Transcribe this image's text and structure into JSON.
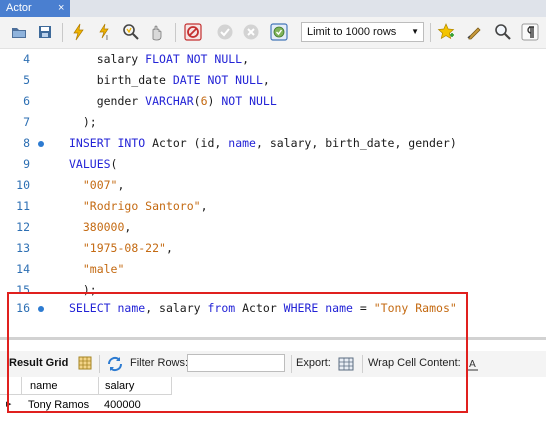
{
  "tab": {
    "title": "Actor",
    "close_glyph": "×"
  },
  "toolbar": {
    "limit_label": "Limit to 1000 rows",
    "icons": [
      "open-file-icon",
      "save-icon",
      "execute-icon",
      "execute-current-icon",
      "explain-icon",
      "stop-icon",
      "toggle-continue-on-error-icon",
      "commit-icon",
      "rollback-icon",
      "autocommit-icon",
      "beautify-icon",
      "find-icon",
      "invisible-chars-icon"
    ]
  },
  "editor": {
    "lines": [
      {
        "n": "4",
        "tokens": [
          [
            "plain",
            "    salary "
          ],
          [
            "kw",
            "FLOAT NOT NULL"
          ],
          [
            "plain",
            ","
          ]
        ]
      },
      {
        "n": "5",
        "tokens": [
          [
            "plain",
            "    birth_date "
          ],
          [
            "kw",
            "DATE NOT NULL"
          ],
          [
            "plain",
            ","
          ]
        ]
      },
      {
        "n": "6",
        "tokens": [
          [
            "plain",
            "    gender "
          ],
          [
            "kw",
            "VARCHAR"
          ],
          [
            "plain",
            "("
          ],
          [
            "str",
            "6"
          ],
          [
            "plain",
            ") "
          ],
          [
            "kw",
            "NOT NULL"
          ]
        ]
      },
      {
        "n": "7",
        "tokens": [
          [
            "plain",
            "  );"
          ]
        ]
      },
      {
        "n": "8",
        "dot": true,
        "tokens": [
          [
            "kw",
            "INSERT INTO"
          ],
          [
            "plain",
            " Actor (id, "
          ],
          [
            "kw",
            "name"
          ],
          [
            "plain",
            ", salary, birth_date, gender)"
          ]
        ]
      },
      {
        "n": "9",
        "tokens": [
          [
            "kw",
            "VALUES"
          ],
          [
            "plain",
            "("
          ]
        ]
      },
      {
        "n": "10",
        "tokens": [
          [
            "plain",
            "  "
          ],
          [
            "str",
            "\"007\""
          ],
          [
            "plain",
            ","
          ]
        ]
      },
      {
        "n": "11",
        "tokens": [
          [
            "plain",
            "  "
          ],
          [
            "str",
            "\"Rodrigo Santoro\""
          ],
          [
            "plain",
            ","
          ]
        ]
      },
      {
        "n": "12",
        "tokens": [
          [
            "plain",
            "  "
          ],
          [
            "str",
            "380000"
          ],
          [
            "plain",
            ","
          ]
        ]
      },
      {
        "n": "13",
        "tokens": [
          [
            "plain",
            "  "
          ],
          [
            "str",
            "\"1975-08-22\""
          ],
          [
            "plain",
            ","
          ]
        ]
      },
      {
        "n": "14",
        "tokens": [
          [
            "plain",
            "  "
          ],
          [
            "str",
            "\"male\""
          ]
        ]
      },
      {
        "n": "15",
        "tokens": [
          [
            "plain",
            "  );"
          ]
        ]
      },
      {
        "n": "16",
        "dot": true,
        "tokens": [
          [
            "kw",
            "SELECT"
          ],
          [
            "plain",
            " "
          ],
          [
            "kw",
            "name"
          ],
          [
            "plain",
            ", salary "
          ],
          [
            "kw",
            "from"
          ],
          [
            "plain",
            " Actor "
          ],
          [
            "kw",
            "WHERE"
          ],
          [
            "plain",
            " "
          ],
          [
            "kw",
            "name"
          ],
          [
            "plain",
            " = "
          ],
          [
            "str",
            "\"Tony Ramos\""
          ]
        ]
      }
    ]
  },
  "results": {
    "tab_label": "Result Grid",
    "filter_label": "Filter Rows:",
    "filter_value": "",
    "export_label": "Export:",
    "wrap_label": "Wrap Cell Content:",
    "columns": [
      "name",
      "salary"
    ],
    "rows": [
      [
        "Tony Ramos",
        "400000"
      ]
    ]
  },
  "colors": {
    "keyword": "#2323d6",
    "string": "#c46a12",
    "highlight_box": "#e0201e",
    "tab_bg": "#4a7fd0"
  }
}
